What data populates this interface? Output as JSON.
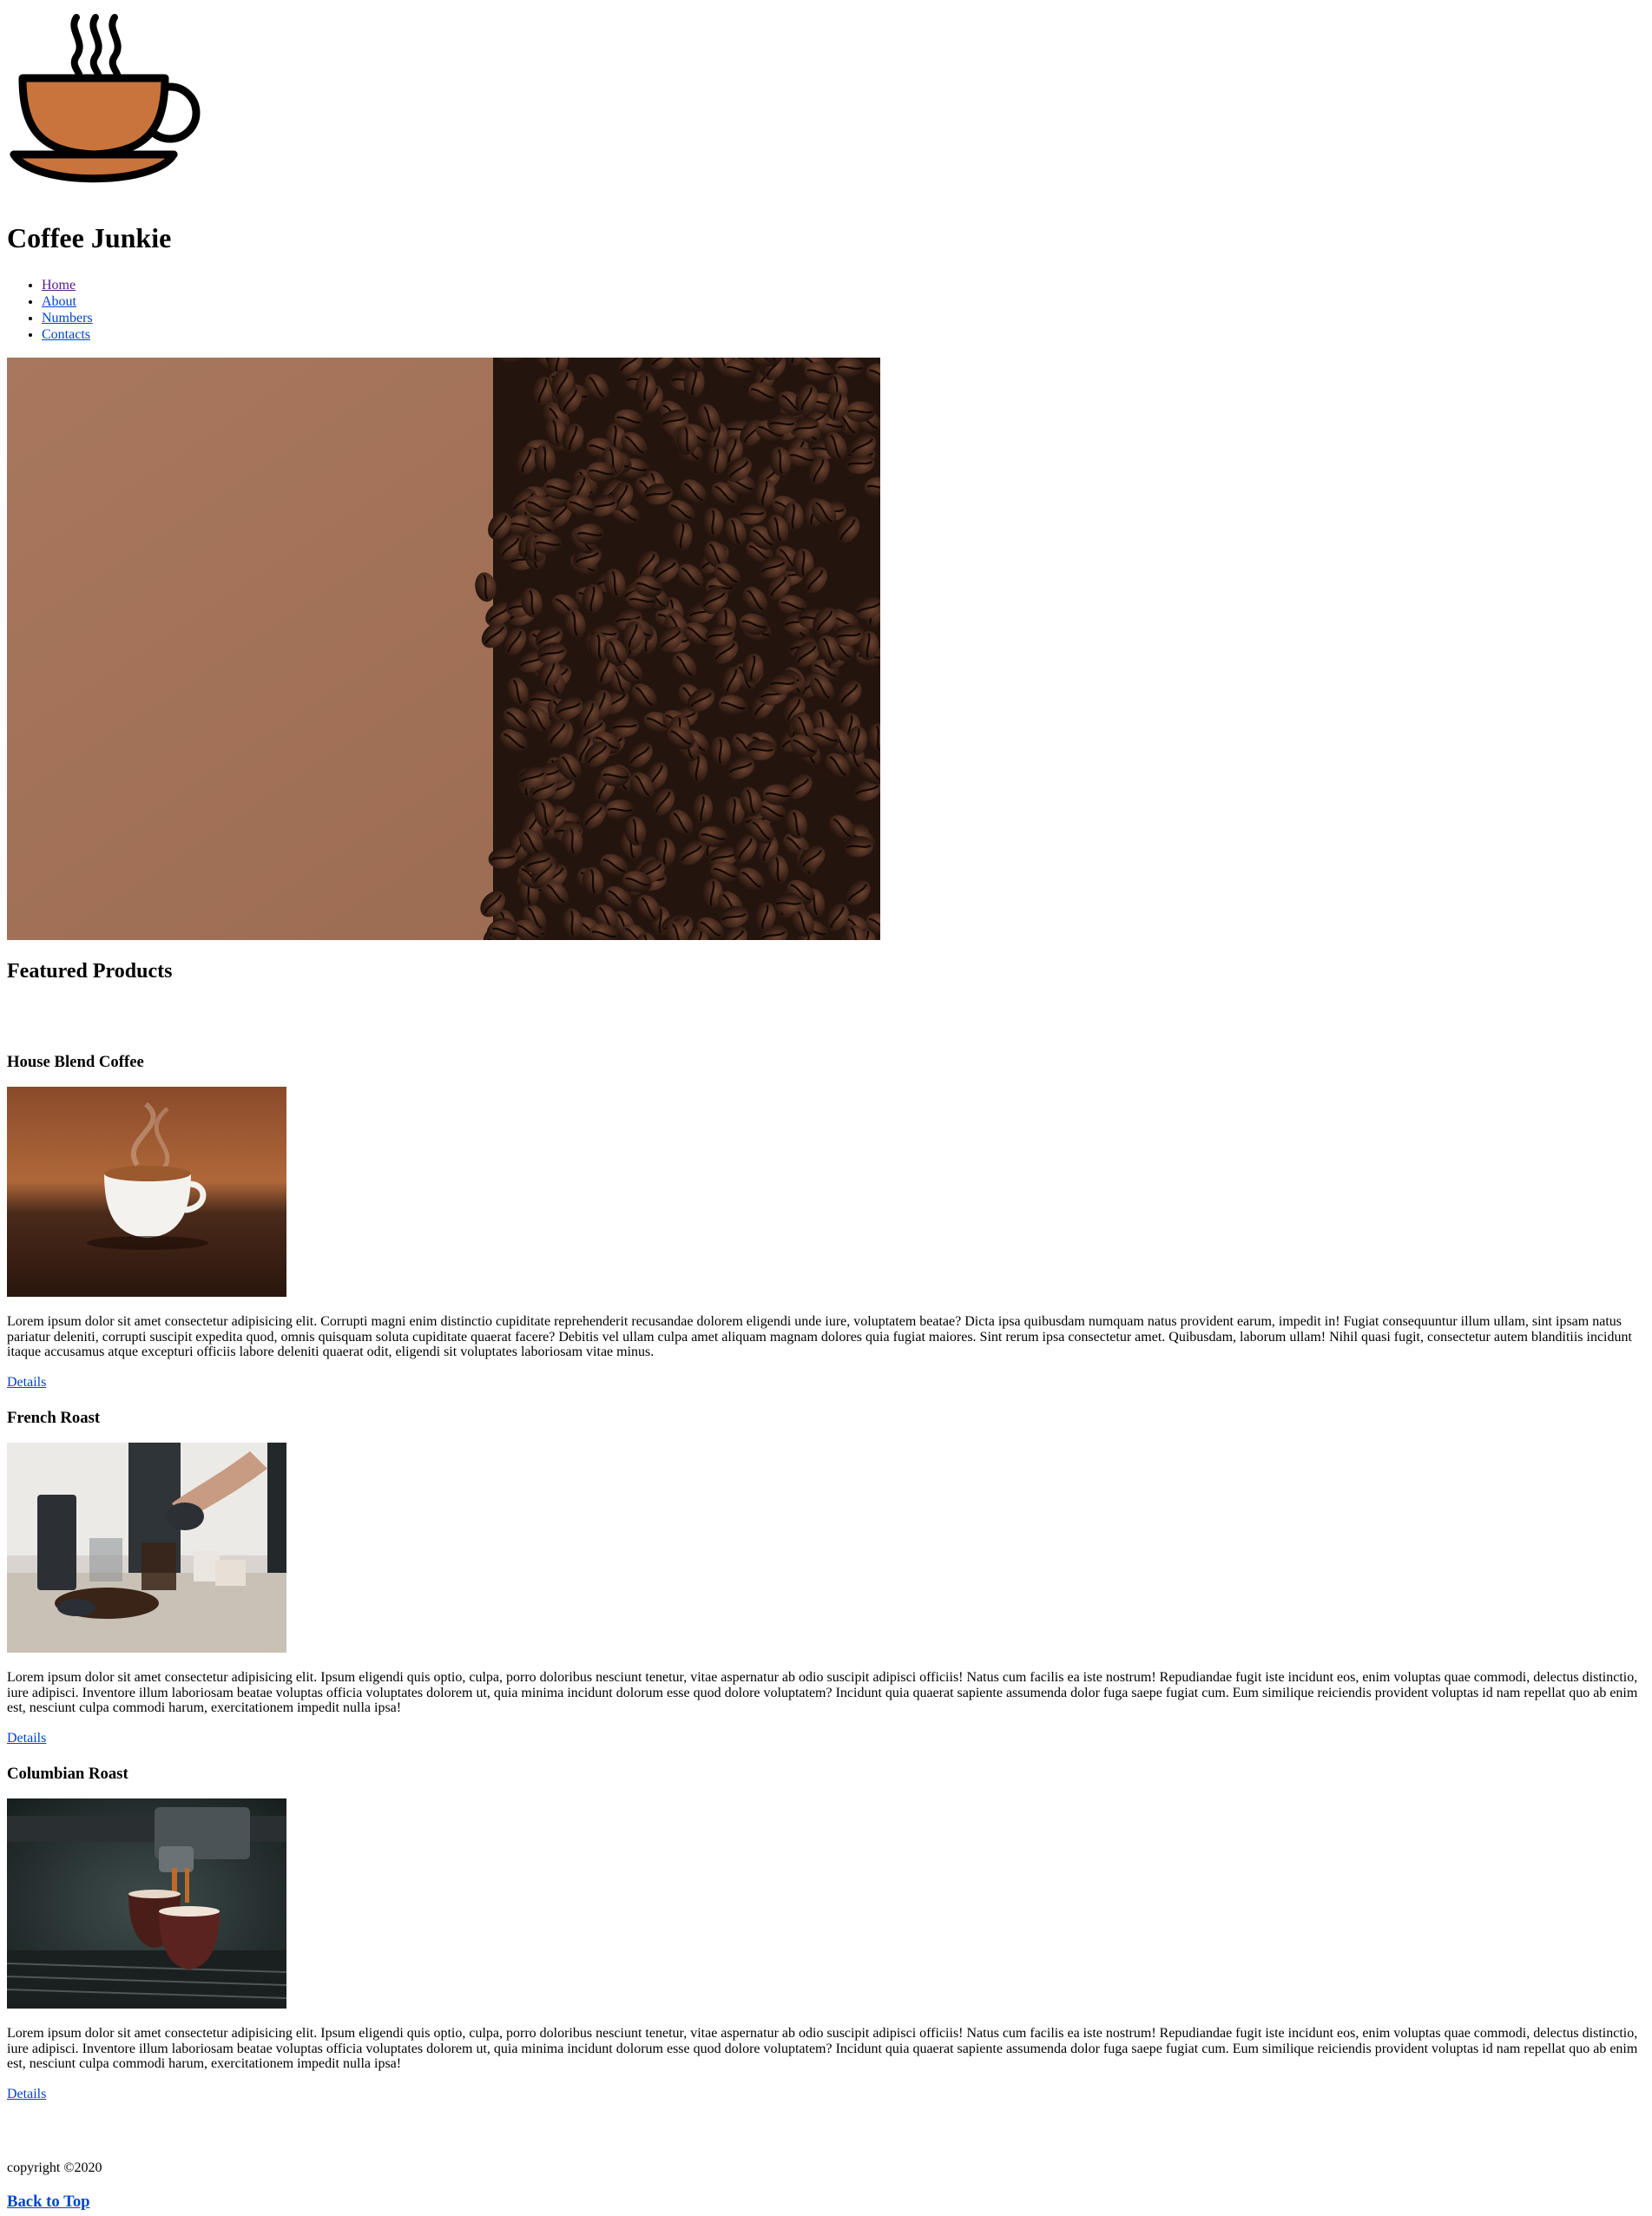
{
  "site": {
    "logo_icon": "coffee-cup-icon",
    "title": "Coffee Junkie"
  },
  "nav": {
    "items": [
      {
        "label": "Home"
      },
      {
        "label": "About"
      },
      {
        "label": "Numbers"
      },
      {
        "label": "Contacts"
      }
    ]
  },
  "hero": {
    "image": "coffee-beans-on-brown-background"
  },
  "featured": {
    "heading": "Featured Products",
    "products": [
      {
        "name": "House Blend Coffee",
        "image": "steaming-cup-on-beans",
        "description": "Lorem ipsum dolor sit amet consectetur adipisicing elit. Corrupti magni enim distinctio cupiditate reprehenderit recusandae dolorem eligendi unde iure, voluptatem beatae? Dicta ipsa quibusdam numquam natus provident earum, impedit in! Fugiat consequuntur illum ullam, sint ipsam natus pariatur deleniti, corrupti suscipit expedita quod, omnis quisquam soluta cupiditate quaerat facere? Debitis vel ullam culpa amet aliquam magnam dolores quia fugiat maiores. Sint rerum ipsa consectetur amet. Quibusdam, laborum ullam! Nihil quasi fugit, consectetur autem blanditiis incidunt itaque accusamus atque excepturi officiis labore deleniti quaerat odit, eligendi sit voluptates laboriosam vitae minus.",
        "link": "Details"
      },
      {
        "name": "French Roast",
        "image": "pour-over-coffee-table",
        "description": "Lorem ipsum dolor sit amet consectetur adipisicing elit. Ipsum eligendi quis optio, culpa, porro doloribus nesciunt tenetur, vitae aspernatur ab odio suscipit adipisci officiis! Natus cum facilis ea iste nostrum! Repudiandae fugit iste incidunt eos, enim voluptas quae commodi, delectus distinctio, iure adipisci. Inventore illum laboriosam beatae voluptas officia voluptates dolorem ut, quia minima incidunt dolorum esse quod dolore voluptatem? Incidunt quia quaerat sapiente assumenda dolor fuga saepe fugiat cum. Eum similique reiciendis provident voluptas id nam repellat quo ab enim est, nesciunt culpa commodi harum, exercitationem impedit nulla ipsa!",
        "link": "Details"
      },
      {
        "name": "Columbian Roast",
        "image": "espresso-machine-pouring",
        "description": "Lorem ipsum dolor sit amet consectetur adipisicing elit. Ipsum eligendi quis optio, culpa, porro doloribus nesciunt tenetur, vitae aspernatur ab odio suscipit adipisci officiis! Natus cum facilis ea iste nostrum! Repudiandae fugit iste incidunt eos, enim voluptas quae commodi, delectus distinctio, iure adipisci. Inventore illum laboriosam beatae voluptas officia voluptates dolorem ut, quia minima incidunt dolorum esse quod dolore voluptatem? Incidunt quia quaerat sapiente assumenda dolor fuga saepe fugiat cum. Eum similique reiciendis provident voluptas id nam repellat quo ab enim est, nesciunt culpa commodi harum, exercitationem impedit nulla ipsa!",
        "link": "Details"
      }
    ]
  },
  "footer": {
    "copyright": "copyright ©2020",
    "back_to_top": "Back to Top"
  },
  "colors": {
    "link": "#0044cc",
    "visited_link": "#551a8b",
    "cup_fill": "#c8743c"
  }
}
